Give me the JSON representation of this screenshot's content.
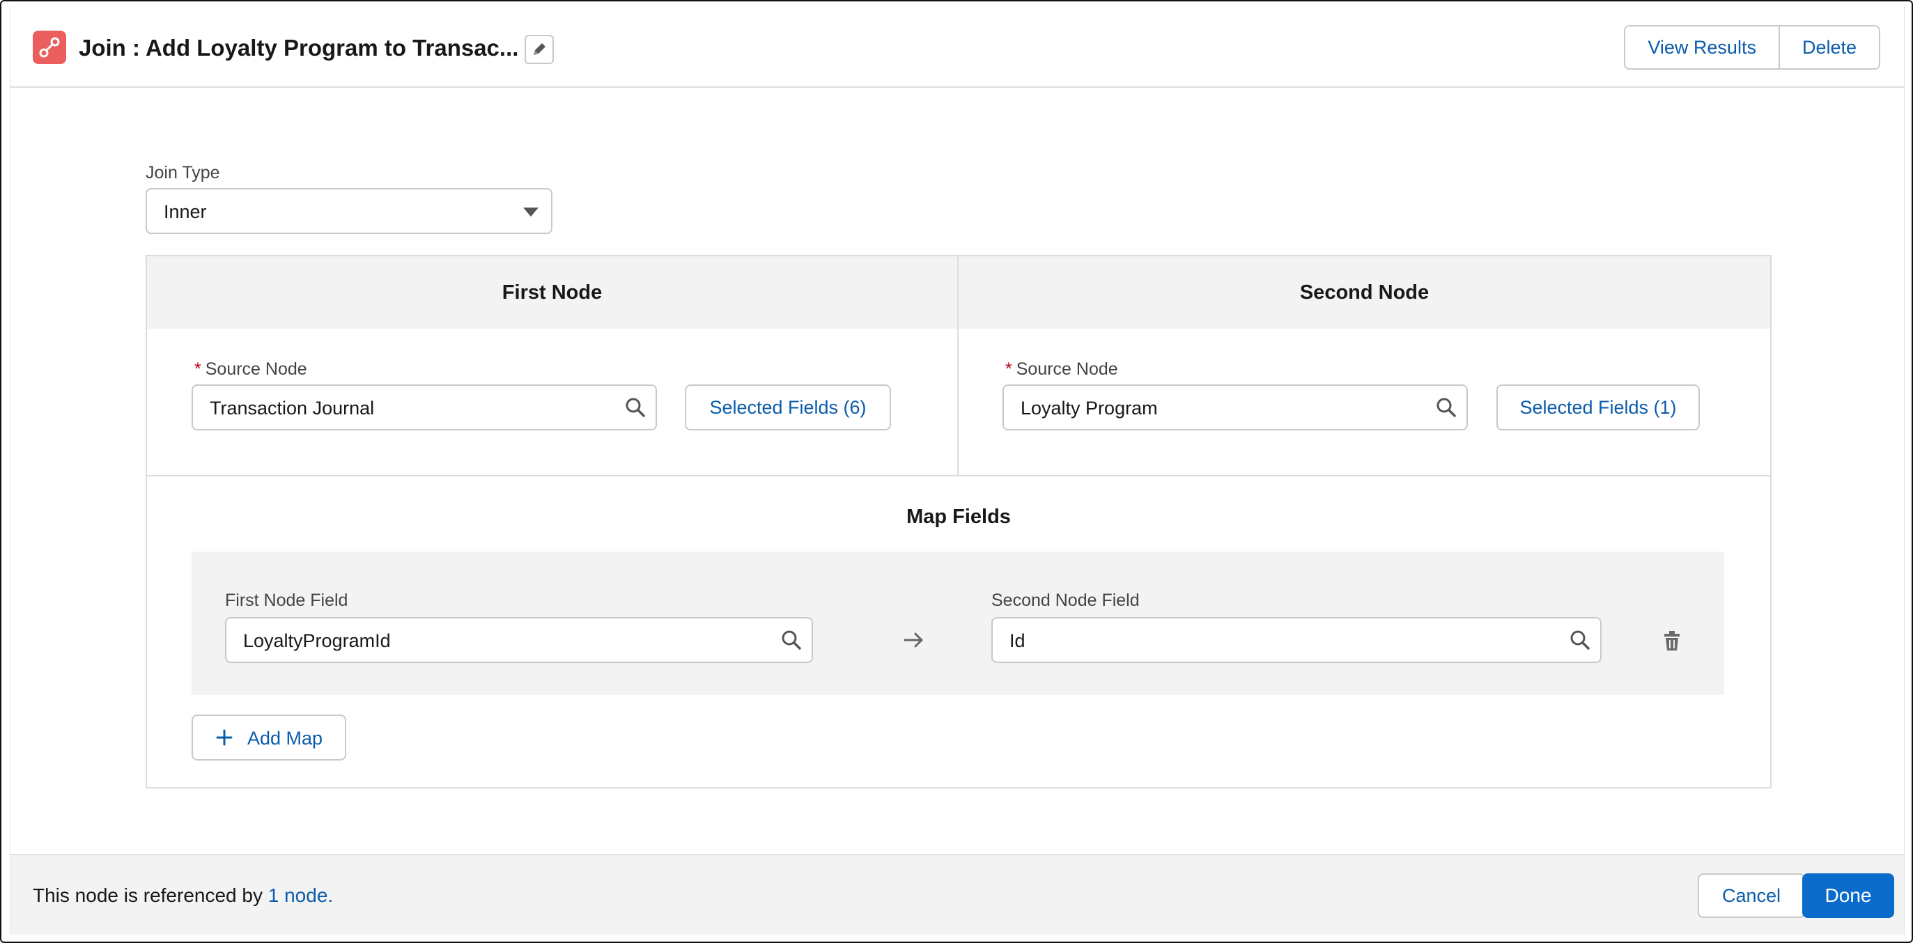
{
  "header": {
    "title_prefix": "Join : ",
    "title": "Add Loyalty Program to Transac...",
    "buttons": {
      "view_results": "View Results",
      "delete": "Delete"
    }
  },
  "join_type": {
    "label": "Join Type",
    "value": "Inner"
  },
  "first_node": {
    "heading": "First Node",
    "required_mark": "*",
    "source_label": "Source Node",
    "source_value": "Transaction Journal",
    "selected_fields": "Selected Fields (6)"
  },
  "second_node": {
    "heading": "Second Node",
    "required_mark": "*",
    "source_label": "Source Node",
    "source_value": "Loyalty Program",
    "selected_fields": "Selected Fields (1)"
  },
  "map_fields": {
    "title": "Map Fields",
    "first_label": "First Node Field",
    "first_value": "LoyaltyProgramId",
    "second_label": "Second Node Field",
    "second_value": "Id",
    "add_map": "Add Map"
  },
  "footer": {
    "text": "This node is referenced by",
    "link": "1 node.",
    "cancel": "Cancel",
    "done": "Done"
  },
  "colors": {
    "brand": "#0b5cab",
    "node_icon": "#ea5e5e",
    "required": "#ba0517"
  },
  "icons": [
    "join-node-icon",
    "pencil-icon",
    "search-icon",
    "arrow-right-icon",
    "trash-icon",
    "plus-icon",
    "chevron-down-icon"
  ]
}
